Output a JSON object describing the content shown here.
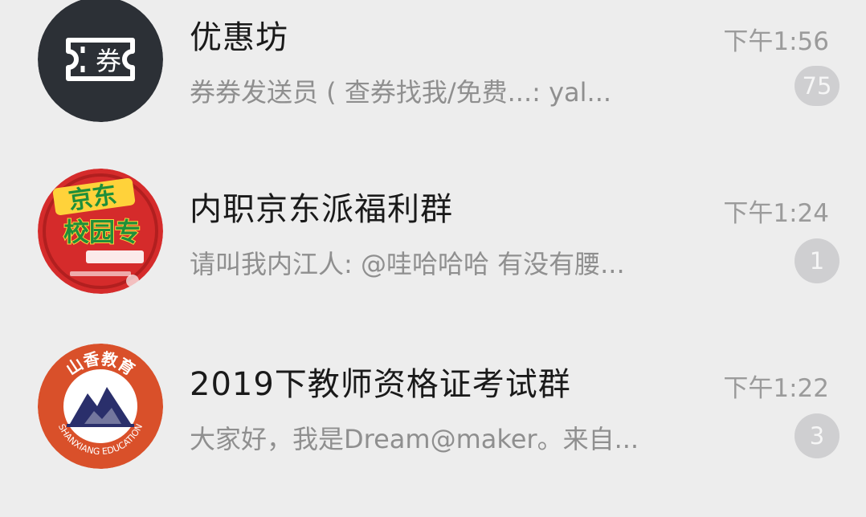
{
  "chats": [
    {
      "title": "优惠坊",
      "time": "下午1:56",
      "preview": "券券发送员 ( 查券找我/免费...: yal...",
      "badge": "75",
      "avatar": {
        "glyph": "券",
        "icon": "ticket-icon",
        "bg": "#2c3036"
      }
    },
    {
      "title": "内职京东派福利群",
      "time": "下午1:24",
      "preview": "请叫我内江人: @哇哈哈哈 有没有腰...",
      "badge": "1",
      "avatar": {
        "line1": "京东",
        "line2": "校园专",
        "bg": "#d52b2b"
      }
    },
    {
      "title": "2019下教师资格证考试群",
      "time": "下午1:22",
      "preview": "大家好，我是Dream@maker。来自...",
      "badge": "3",
      "avatar": {
        "top": "山香教育",
        "bottom": "SHANXIANG EDUCATION",
        "bg": "#d9502a"
      }
    }
  ]
}
